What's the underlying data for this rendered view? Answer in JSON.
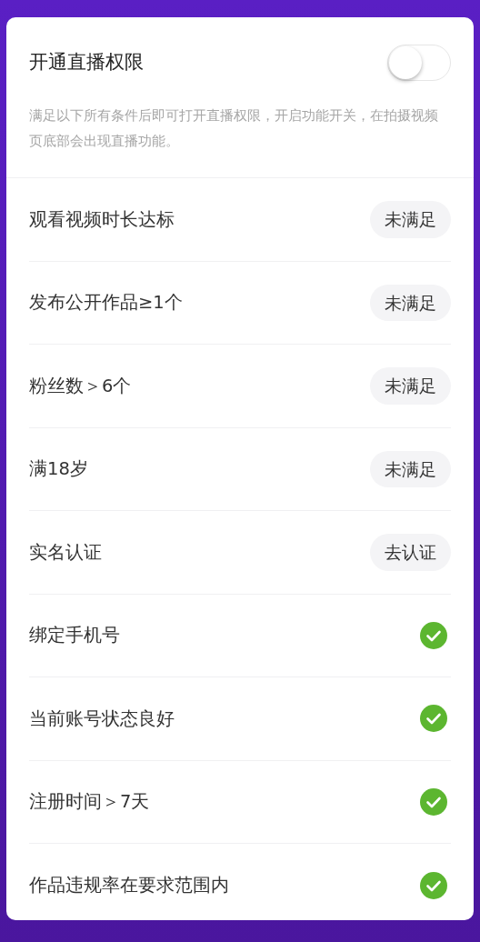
{
  "header": {
    "title": "开通直播权限",
    "on": false,
    "description": "满足以下所有条件后即可打开直播权限，开启功能开关，在拍摄视频页底部会出现直播功能。"
  },
  "conditions": [
    {
      "label": "观看视频时长达标",
      "kind": "pending",
      "status": "未满足"
    },
    {
      "label": "发布公开作品≥1个",
      "kind": "pending",
      "status": "未满足"
    },
    {
      "label": "粉丝数＞6个",
      "kind": "pending",
      "status": "未满足"
    },
    {
      "label": "满18岁",
      "kind": "pending",
      "status": "未满足"
    },
    {
      "label": "实名认证",
      "kind": "action",
      "status": "去认证"
    },
    {
      "label": "绑定手机号",
      "kind": "met"
    },
    {
      "label": "当前账号状态良好",
      "kind": "met"
    },
    {
      "label": "注册时间＞7天",
      "kind": "met"
    },
    {
      "label": "作品违规率在要求范围内",
      "kind": "met"
    }
  ]
}
